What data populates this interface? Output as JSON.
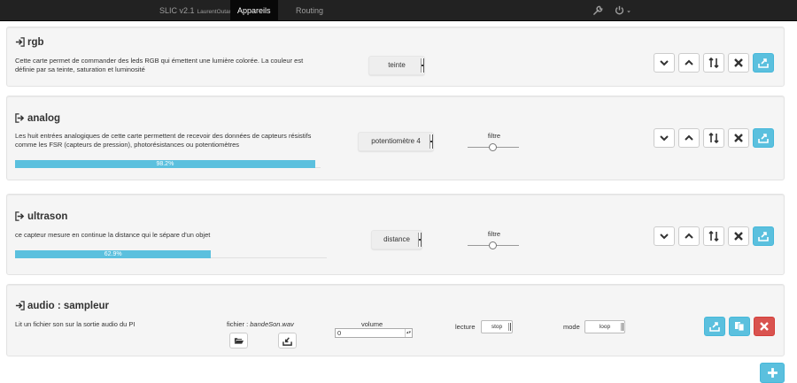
{
  "navbar": {
    "brand_version": "SLIC v2.1",
    "brand_user": "LaurentOutan",
    "tabs": [
      {
        "label": "Appareils",
        "active": true
      },
      {
        "label": "Routing",
        "active": false
      }
    ],
    "icons": [
      "wrench-icon",
      "power-icon",
      "caret-down-icon"
    ]
  },
  "colors": {
    "navbar_bg": "#222222",
    "panel_bg": "#f5f5f5",
    "info": "#5bc0de",
    "danger": "#d9534f"
  },
  "panels": [
    {
      "title": "rgb",
      "title_icon": "sign-in-icon",
      "description": "Cette carte permet de commander des leds RGB qui émettent une lumière colorée. La couleur est définie par sa teinte, saturation et luminosité",
      "select_value": "teinte"
    },
    {
      "title": "analog",
      "title_icon": "sign-out-icon",
      "description": "Les huit entrées analogiques de cette carte permettent de recevoir des données de capteurs résistifs comme les FSR (capteurs de pression), photorésistances ou potentiomètres",
      "select_value": "potentiomètre 4",
      "slider_label": "filtre",
      "slider_level": 0.5,
      "progress_label": "98.2%",
      "progress_value": 98.2
    },
    {
      "title": "ultrason",
      "title_icon": "sign-out-icon",
      "description": "ce capteur mesure en continue la distance qui le sépare d'un objet",
      "select_value": "distance",
      "slider_label": "filtre",
      "slider_level": 0.5,
      "progress_label": "62.9%",
      "progress_value": 62.9
    },
    {
      "title": "audio : sampleur",
      "title_icon": "sign-in-icon",
      "description": "Lit un fichier son sur la sortie audio du PI",
      "file_label": "fichier : ",
      "file_name": "bandeSon.wav",
      "volume_label": "volume",
      "volume_value": "0",
      "lecture_label": "lecture",
      "lecture_value": "stop",
      "mode_label": "mode",
      "mode_value": "loop"
    }
  ],
  "panel_buttons": [
    "chevron-down-icon",
    "chevron-up-icon",
    "sort-icon",
    "remove-icon",
    "export-icon"
  ],
  "audio_buttons": [
    "export-icon",
    "copy-icon",
    "remove-icon"
  ],
  "add_button_icon": "plus-icon"
}
